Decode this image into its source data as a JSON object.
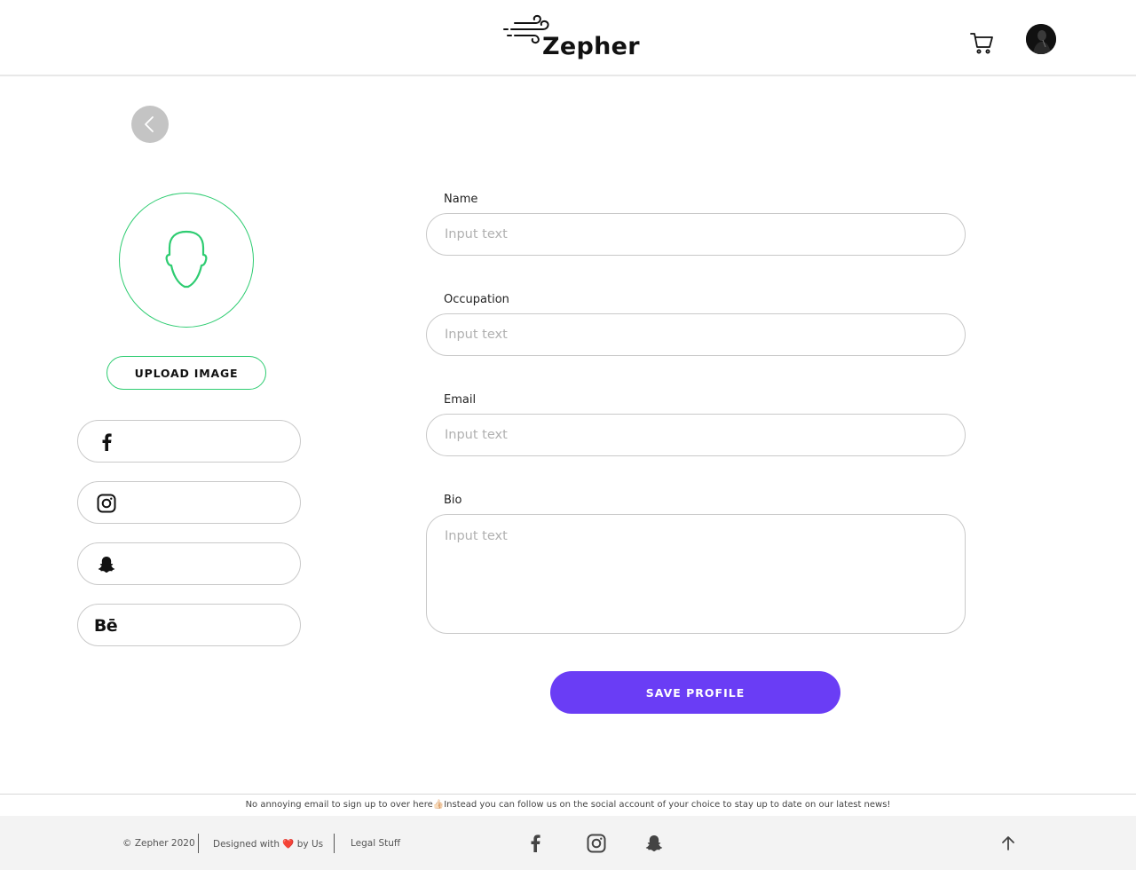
{
  "header": {
    "brand": "Zepher"
  },
  "profile": {
    "upload_label": "UPLOAD IMAGE"
  },
  "social_fields": [
    {
      "network": "facebook",
      "icon": "facebook-icon",
      "value": ""
    },
    {
      "network": "instagram",
      "icon": "instagram-icon",
      "value": ""
    },
    {
      "network": "snapchat",
      "icon": "snapchat-icon",
      "value": ""
    },
    {
      "network": "behance",
      "icon": "behance-icon",
      "glyph": "Bē",
      "value": ""
    }
  ],
  "form": {
    "name": {
      "label": "Name",
      "placeholder": "Input text",
      "value": ""
    },
    "occupation": {
      "label": "Occupation",
      "placeholder": "Input text",
      "value": ""
    },
    "email": {
      "label": "Email",
      "placeholder": "Input text",
      "value": ""
    },
    "bio": {
      "label": "Bio",
      "placeholder": "Input text",
      "value": ""
    },
    "save_label": "SAVE PROFILE"
  },
  "footer": {
    "note_before": "No annoying email to sign up to over here",
    "note_emoji": "👍🏻",
    "note_after": "Instead you can follow us on the social account of your choice to stay up to date on our latest news!",
    "copyright": "© Zepher 2020",
    "designed_before": "Designed with",
    "designed_heart": "❤️",
    "designed_after": "by Us",
    "legal": "Legal Stuff"
  },
  "colors": {
    "accent_green": "#2ecc71",
    "primary_purple": "#6a3df5",
    "border_gray": "#c9c9c9",
    "footer_bg": "#f3f3f3"
  }
}
